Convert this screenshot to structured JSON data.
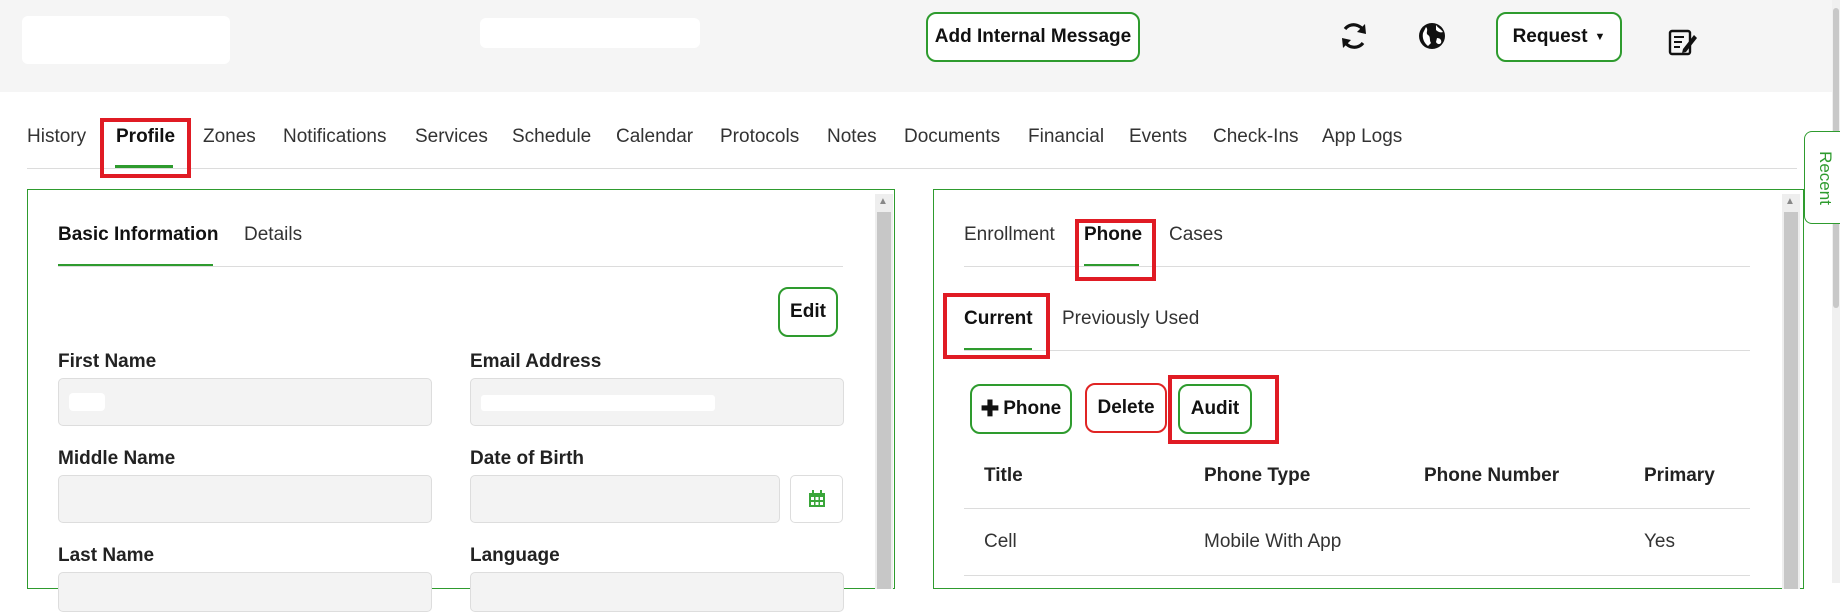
{
  "header": {
    "add_message_label": "Add Internal Message",
    "request_label": "Request",
    "icons": [
      "refresh-icon",
      "globe-icon",
      "chevron-down-icon",
      "notes-edit-icon"
    ]
  },
  "main_tabs": [
    "History",
    "Profile",
    "Zones",
    "Notifications",
    "Services",
    "Schedule",
    "Calendar",
    "Protocols",
    "Notes",
    "Documents",
    "Financial",
    "Events",
    "Check-Ins",
    "App Logs"
  ],
  "active_main_tab": "Profile",
  "left_panel": {
    "tabs": [
      "Basic Information",
      "Details"
    ],
    "active_tab": "Basic Information",
    "edit_label": "Edit",
    "fields": {
      "first_name": "First Name",
      "email_address": "Email Address",
      "middle_name": "Middle Name",
      "date_of_birth": "Date of Birth",
      "last_name": "Last Name",
      "language": "Language"
    },
    "date_icon": "calendar-icon"
  },
  "right_panel": {
    "tabs": [
      "Enrollment",
      "Phone",
      "Cases"
    ],
    "active_tab": "Phone",
    "sub_tabs": [
      "Current",
      "Previously Used"
    ],
    "active_sub_tab": "Current",
    "add_phone_label": "Phone",
    "delete_label": "Delete",
    "audit_label": "Audit",
    "table": {
      "headers": [
        "Title",
        "Phone Type",
        "Phone Number",
        "Primary"
      ],
      "rows": [
        [
          "Cell",
          "Mobile With App",
          "",
          "Yes"
        ]
      ]
    }
  },
  "recent_label": "Recent",
  "colors": {
    "accent_green": "#2e9b2e",
    "highlight_red": "#e01b24",
    "header_bg": "#f5f5f5"
  }
}
